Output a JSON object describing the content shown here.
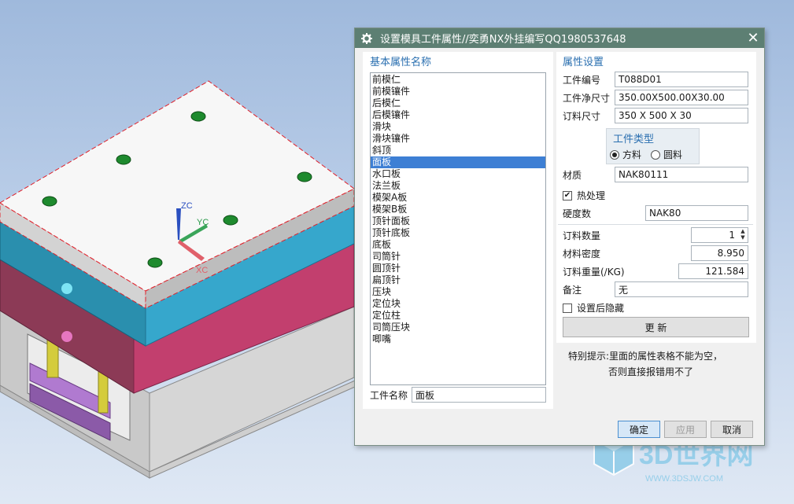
{
  "axes": {
    "zc": "ZC",
    "yc": "YC",
    "xc": "XC"
  },
  "dialog": {
    "title": "设置模具工件属性//奕勇NX外挂编写QQ1980537648",
    "left": {
      "section_title": "基本属性名称",
      "items": [
        "前模仁",
        "前模镶件",
        "后模仁",
        "后模镶件",
        "滑块",
        "滑块镶件",
        "斜顶",
        "面板",
        "水口板",
        "法兰板",
        "模架A板",
        "模架B板",
        "顶针面板",
        "顶针底板",
        "底板",
        "司筒针",
        "圆顶针",
        "扁顶针",
        "压块",
        "定位块",
        "定位柱",
        "司筒压块",
        "唧嘴"
      ],
      "selected_index": 7,
      "name_label": "工件名称",
      "name_value": "面板"
    },
    "right": {
      "section_title": "属性设置",
      "part_no_label": "工件编号",
      "part_no_value": "T088D01",
      "net_size_label": "工件净尺寸",
      "net_size_value": "350.00X500.00X30.00",
      "order_size_label": "订料尺寸",
      "order_size_value": "350 X 500 X 30",
      "type_title": "工件类型",
      "type_square": "方料",
      "type_round": "圆料",
      "type_selected": "square",
      "material_label": "材质",
      "material_value": "NAK80111",
      "heat_label": "热处理",
      "heat_checked": true,
      "hardness_label": "硬度数",
      "hardness_value": "NAK80",
      "qty_label": "订料数量",
      "qty_value": "1",
      "density_label": "材料密度",
      "density_value": "8.950",
      "weight_label": "订料重量(/KG)",
      "weight_value": "121.584",
      "remark_label": "备注",
      "remark_value": "无",
      "hide_label": "设置后隐藏",
      "hide_checked": false,
      "update_label": "更  新"
    },
    "hint_line1": "特别提示:里面的属性表格不能为空，",
    "hint_line2": "否则直接报错用不了",
    "ok_label": "确定",
    "apply_label": "应用",
    "cancel_label": "取消"
  },
  "watermark": {
    "title": "3D世界网",
    "url": "WWW.3DSJW.COM"
  }
}
